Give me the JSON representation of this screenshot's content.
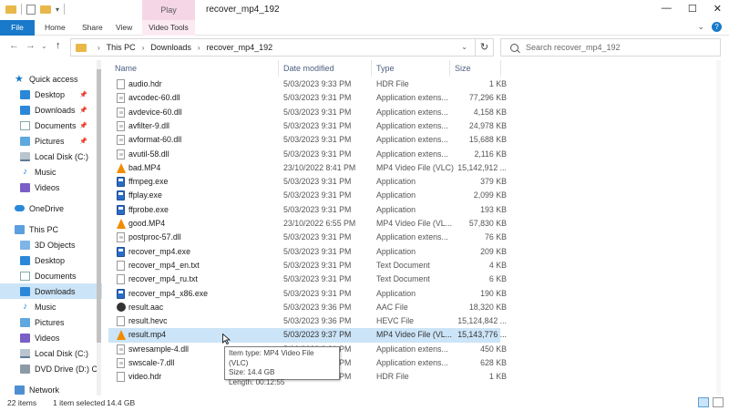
{
  "titlebar": {
    "contextual_tab": "Play",
    "title": "recover_mp4_192",
    "minimize": "—",
    "maximize": "☐",
    "close": "✕"
  },
  "ribbon": {
    "tabs": [
      "File",
      "Home",
      "Share",
      "View",
      "Video Tools"
    ]
  },
  "address": {
    "crumbs": [
      "This PC",
      "Downloads",
      "recover_mp4_192"
    ],
    "search_placeholder": "Search recover_mp4_192"
  },
  "nav_pane": {
    "items": [
      {
        "label": "Quick access",
        "icon": "star-icon"
      },
      {
        "label": "Desktop",
        "icon": "desktop-icon",
        "pinned": true
      },
      {
        "label": "Downloads",
        "icon": "downloads-icon",
        "pinned": true
      },
      {
        "label": "Documents",
        "icon": "documents-icon",
        "pinned": true
      },
      {
        "label": "Pictures",
        "icon": "pictures-icon",
        "pinned": true
      },
      {
        "label": "Local Disk (C:)",
        "icon": "disk-icon"
      },
      {
        "label": "Music",
        "icon": "music-icon"
      },
      {
        "label": "Videos",
        "icon": "videos-icon"
      },
      {
        "label": "OneDrive",
        "icon": "cloud-icon"
      },
      {
        "label": "This PC",
        "icon": "pc-icon"
      },
      {
        "label": "3D Objects",
        "icon": "3d-objects-icon"
      },
      {
        "label": "Desktop",
        "icon": "desktop-icon"
      },
      {
        "label": "Documents",
        "icon": "documents-icon"
      },
      {
        "label": "Downloads",
        "icon": "downloads-icon",
        "selected": true
      },
      {
        "label": "Music",
        "icon": "music-icon"
      },
      {
        "label": "Pictures",
        "icon": "pictures-icon"
      },
      {
        "label": "Videos",
        "icon": "videos-icon"
      },
      {
        "label": "Local Disk (C:)",
        "icon": "disk-icon"
      },
      {
        "label": "DVD Drive (D:) C",
        "icon": "dvd-icon"
      },
      {
        "label": "Network",
        "icon": "network-icon"
      }
    ]
  },
  "columns": {
    "name": "Name",
    "date": "Date modified",
    "type": "Type",
    "size": "Size"
  },
  "files": [
    {
      "name": "audio.hdr",
      "date": "5/03/2023 9:33 PM",
      "type": "HDR File",
      "size": "1 KB",
      "icon": "txt"
    },
    {
      "name": "avcodec-60.dll",
      "date": "5/03/2023 9:31 PM",
      "type": "Application extens...",
      "size": "77,296 KB",
      "icon": "dll"
    },
    {
      "name": "avdevice-60.dll",
      "date": "5/03/2023 9:31 PM",
      "type": "Application extens...",
      "size": "4,158 KB",
      "icon": "dll"
    },
    {
      "name": "avfilter-9.dll",
      "date": "5/03/2023 9:31 PM",
      "type": "Application extens...",
      "size": "24,978 KB",
      "icon": "dll"
    },
    {
      "name": "avformat-60.dll",
      "date": "5/03/2023 9:31 PM",
      "type": "Application extens...",
      "size": "15,688 KB",
      "icon": "dll"
    },
    {
      "name": "avutil-58.dll",
      "date": "5/03/2023 9:31 PM",
      "type": "Application extens...",
      "size": "2,116 KB",
      "icon": "dll"
    },
    {
      "name": "bad.MP4",
      "date": "23/10/2022 8:41 PM",
      "type": "MP4 Video File (VLC)",
      "size": "15,142,912 ...",
      "icon": "vlc"
    },
    {
      "name": "ffmpeg.exe",
      "date": "5/03/2023 9:31 PM",
      "type": "Application",
      "size": "379 KB",
      "icon": "exe"
    },
    {
      "name": "ffplay.exe",
      "date": "5/03/2023 9:31 PM",
      "type": "Application",
      "size": "2,099 KB",
      "icon": "exe"
    },
    {
      "name": "ffprobe.exe",
      "date": "5/03/2023 9:31 PM",
      "type": "Application",
      "size": "193 KB",
      "icon": "exe"
    },
    {
      "name": "good.MP4",
      "date": "23/10/2022 6:55 PM",
      "type": "MP4 Video File (VL...",
      "size": "57,830 KB",
      "icon": "vlc"
    },
    {
      "name": "postproc-57.dll",
      "date": "5/03/2023 9:31 PM",
      "type": "Application extens...",
      "size": "76 KB",
      "icon": "dll"
    },
    {
      "name": "recover_mp4.exe",
      "date": "5/03/2023 9:31 PM",
      "type": "Application",
      "size": "209 KB",
      "icon": "exe"
    },
    {
      "name": "recover_mp4_en.txt",
      "date": "5/03/2023 9:31 PM",
      "type": "Text Document",
      "size": "4 KB",
      "icon": "txt"
    },
    {
      "name": "recover_mp4_ru.txt",
      "date": "5/03/2023 9:31 PM",
      "type": "Text Document",
      "size": "6 KB",
      "icon": "txt"
    },
    {
      "name": "recover_mp4_x86.exe",
      "date": "5/03/2023 9:31 PM",
      "type": "Application",
      "size": "190 KB",
      "icon": "exe"
    },
    {
      "name": "result.aac",
      "date": "5/03/2023 9:36 PM",
      "type": "AAC File",
      "size": "18,320 KB",
      "icon": "aac"
    },
    {
      "name": "result.hevc",
      "date": "5/03/2023 9:36 PM",
      "type": "HEVC File",
      "size": "15,124,842 ...",
      "icon": "txt"
    },
    {
      "name": "result.mp4",
      "date": "5/03/2023 9:37 PM",
      "type": "MP4 Video File (VL...",
      "size": "15,143,776 ...",
      "icon": "vlc",
      "selected": true
    },
    {
      "name": "swresample-4.dll",
      "date": "5/03/2023 9:31 PM",
      "type": "Application extens...",
      "size": "450 KB",
      "icon": "dll"
    },
    {
      "name": "swscale-7.dll",
      "date": "5/03/2023 9:31 PM",
      "type": "Application extens...",
      "size": "628 KB",
      "icon": "dll"
    },
    {
      "name": "video.hdr",
      "date": "5/03/2023 9:36 PM",
      "type": "HDR File",
      "size": "1 KB",
      "icon": "txt"
    }
  ],
  "tooltip": {
    "line1": "Item type: MP4 Video File (VLC)",
    "line2": "Size: 14.4 GB",
    "line3": "Length: 00:12:55"
  },
  "status": {
    "count": "22 items",
    "selected": "1 item selected",
    "size": "14.4 GB"
  }
}
